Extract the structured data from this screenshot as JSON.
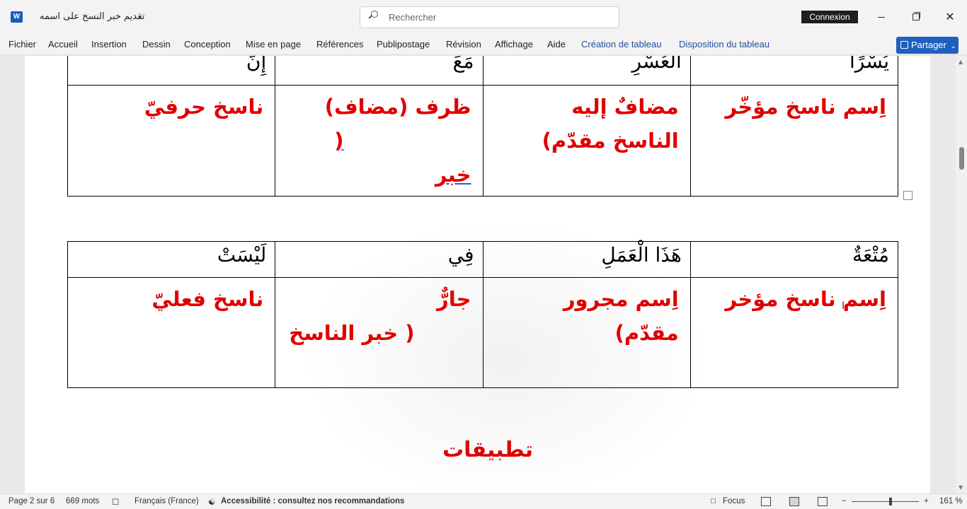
{
  "titlebar": {
    "app_icon": "word-icon",
    "app_letter": "W",
    "doc_title": "تقديم خبر النسخ على اسمه",
    "search_placeholder": "Rechercher",
    "connexion_label": "Connexion",
    "minimize": "minimize-icon",
    "restore": "restore-icon",
    "close_glyph": "✕"
  },
  "ribbon": {
    "tabs": [
      "Fichier",
      "Accueil",
      "Insertion",
      "Dessin",
      "Conception",
      "Mise en page",
      "Références",
      "Publipostage",
      "Révision",
      "Affichage",
      "Aide",
      "Création de tableau",
      "Disposition du tableau"
    ],
    "share_label": "Partager",
    "share_chevron": "⌄"
  },
  "table1": {
    "headers": [
      "إِنَّ",
      "مَعَ",
      "الْعُسْرِ",
      "يُسْرًا"
    ],
    "cells": [
      [
        "ناسخ حرفيّ"
      ],
      [
        "ظرف (مضاف)",
        "(",
        "خبر"
      ],
      [
        "مضافٌ إليه",
        "الناسخ مقدّم)"
      ],
      [
        "اِسم ناسخ مؤخّر"
      ]
    ]
  },
  "table2": {
    "headers": [
      "لَيْسَتْ",
      "فِي",
      "هَذَا الْعَمَلِ",
      "مُتْعَةٌ"
    ],
    "cells": [
      [
        "ناسخ فعليّ"
      ],
      [
        "جارٌّ",
        "( خبر الناسخ"
      ],
      [
        "اِسم مجرور",
        "مقدّم)"
      ],
      [
        "اِسم ناسخ مؤخر"
      ]
    ]
  },
  "heading": "تطبيقات",
  "statusbar": {
    "page": "Page 2 sur 6",
    "words": "669 mots",
    "language": "Français (France)",
    "accessibility": "Accessibilité : consultez nos recommandations",
    "focus": "Focus",
    "zoom_minus": "−",
    "zoom_plus": "+",
    "zoom_level": "161 %"
  },
  "colors": {
    "accent": "#1f5fbf",
    "red_text": "#e00000"
  }
}
